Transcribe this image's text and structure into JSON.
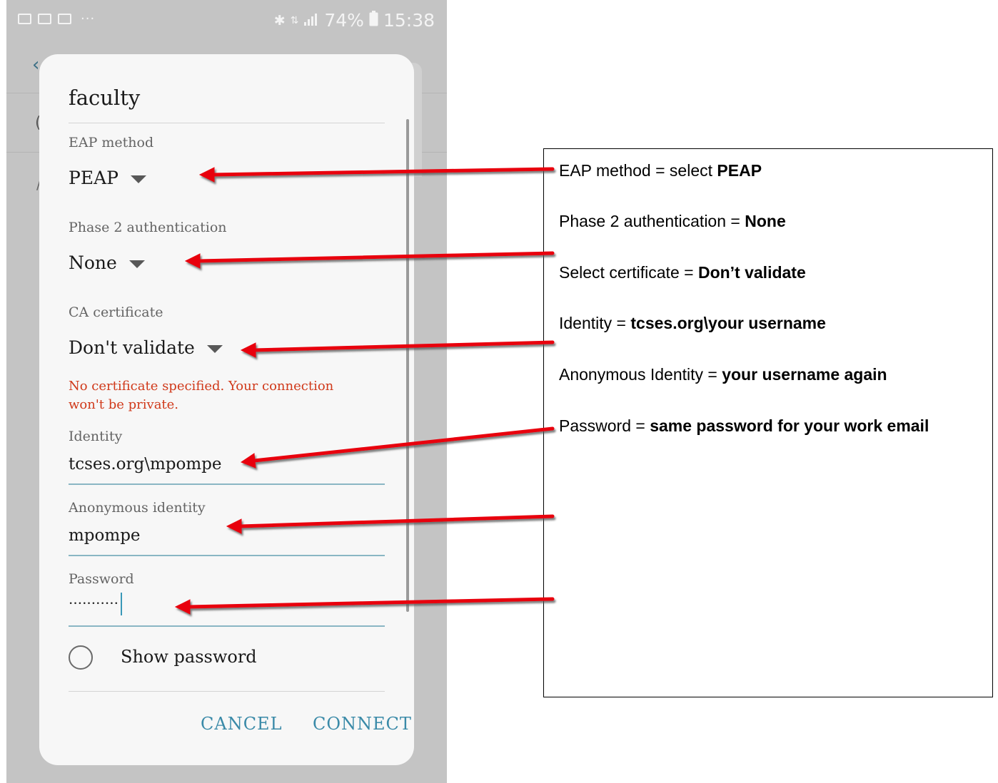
{
  "status_bar": {
    "icons_left": [
      "image-icon",
      "outlook-icon",
      "email-icon"
    ],
    "more": "···",
    "icons_right": [
      "bluetooth-icon",
      "data-icon",
      "signal-icon"
    ],
    "battery": "74%",
    "time": "15:38"
  },
  "dialog": {
    "title": "faculty",
    "eap_method": {
      "label": "EAP method",
      "value": "PEAP"
    },
    "phase2": {
      "label": "Phase 2 authentication",
      "value": "None"
    },
    "ca_certificate": {
      "label": "CA certificate",
      "value": "Don't validate"
    },
    "warning": "No certificate specified. Your connection won't be private.",
    "identity": {
      "label": "Identity",
      "value": "tcses.org\\mpompe"
    },
    "anonymous_identity": {
      "label": "Anonymous identity",
      "value": "mpompe"
    },
    "password": {
      "label": "Password",
      "value": "···········"
    },
    "show_password": {
      "label": "Show password",
      "checked": false
    },
    "buttons": {
      "cancel": "CANCEL",
      "connect": "CONNECT"
    }
  },
  "annotations": [
    {
      "text": "EAP method = select ",
      "bold": "PEAP"
    },
    {
      "text": "Phase 2 authentication = ",
      "bold": "None"
    },
    {
      "text": "Select certificate = ",
      "bold": "Don’t validate"
    },
    {
      "text": "Identity = ",
      "bold": "tcses.org\\your username"
    },
    {
      "text": "Anonymous Identity = ",
      "bold": "your username again"
    },
    {
      "text": "Password = ",
      "bold": "same password for your work email"
    }
  ],
  "colors": {
    "arrow": "#e8000b",
    "accent": "#3a8aa8",
    "warning": "#d0391a",
    "overlay": "#c4c4c4"
  }
}
